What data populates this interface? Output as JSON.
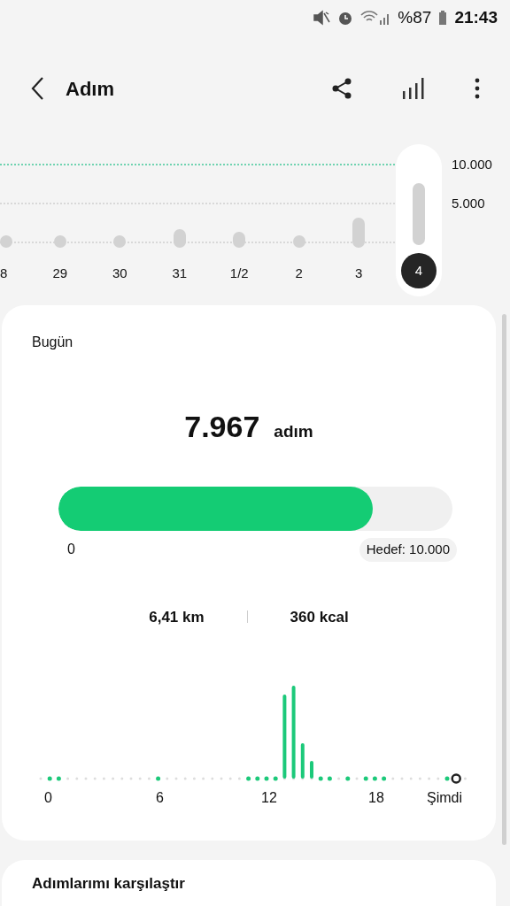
{
  "status_bar": {
    "battery": "%87",
    "time": "21:43"
  },
  "header": {
    "title": "Adım"
  },
  "week_chart": {
    "goal_label": "10.000",
    "mid_label": "5.000",
    "days": [
      {
        "label": "8",
        "selected": false
      },
      {
        "label": "29",
        "selected": false
      },
      {
        "label": "30",
        "selected": false
      },
      {
        "label": "31",
        "selected": false
      },
      {
        "label": "1/2",
        "selected": false
      },
      {
        "label": "2",
        "selected": false
      },
      {
        "label": "3",
        "selected": false
      },
      {
        "label": "4",
        "selected": true
      }
    ]
  },
  "today": {
    "title": "Bugün",
    "steps": "7.967",
    "unit": "adım",
    "progress": {
      "level": 0.7967,
      "start": "0",
      "goal": "Hedef: 10.000"
    },
    "distance": "6,41 km",
    "calories": "360 kcal",
    "hour_axis": [
      "0",
      "6",
      "12",
      "18",
      "Şimdi"
    ]
  },
  "next_card": {
    "title": "Adımlarımı karşılaştır"
  }
}
